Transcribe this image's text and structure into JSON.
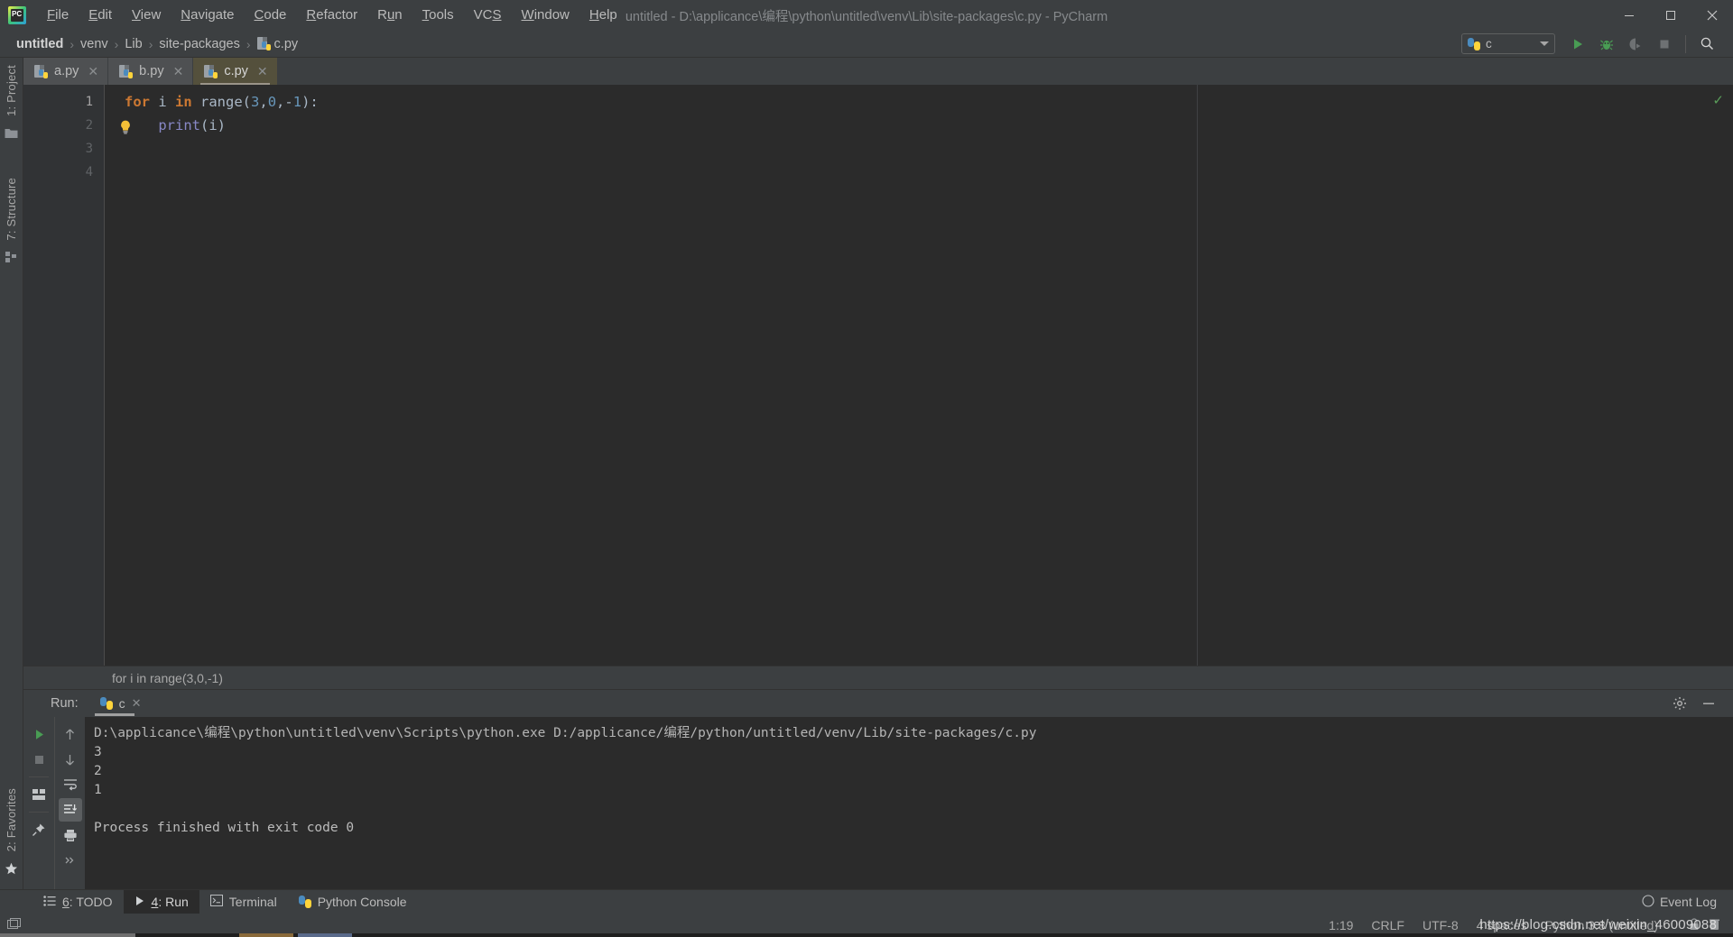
{
  "window": {
    "title": "untitled - D:\\applicance\\编程\\python\\untitled\\venv\\Lib\\site-packages\\c.py - PyCharm",
    "minimize_label": "minimize",
    "maximize_label": "maximize",
    "close_label": "close"
  },
  "menubar": {
    "items": [
      {
        "label": "File"
      },
      {
        "label": "Edit"
      },
      {
        "label": "View"
      },
      {
        "label": "Navigate"
      },
      {
        "label": "Code"
      },
      {
        "label": "Refactor"
      },
      {
        "label": "Run"
      },
      {
        "label": "Tools"
      },
      {
        "label": "VCS"
      },
      {
        "label": "Window"
      },
      {
        "label": "Help"
      }
    ]
  },
  "breadcrumb": {
    "items": [
      "untitled",
      "venv",
      "Lib",
      "site-packages",
      "c.py"
    ],
    "separator": "›"
  },
  "toolbar": {
    "run_config": "c",
    "run_label": "Run",
    "debug_label": "Debug",
    "coverage_label": "Run with Coverage",
    "stop_label": "Stop",
    "search_label": "Search Everywhere"
  },
  "sidebar_left": {
    "top": [
      {
        "label": "1: Project",
        "accesskey": "1"
      },
      {
        "label": "7: Structure",
        "accesskey": "7"
      }
    ],
    "bottom": [
      {
        "label": "2: Favorites",
        "accesskey": "2"
      }
    ]
  },
  "editor": {
    "tabs": [
      {
        "label": "a.py",
        "active": false
      },
      {
        "label": "b.py",
        "active": false
      },
      {
        "label": "c.py",
        "active": true
      }
    ],
    "line_numbers": [
      "1",
      "2",
      "3",
      "4"
    ],
    "code_lines": [
      {
        "tokens": [
          {
            "t": "for",
            "c": "kw"
          },
          {
            "t": " i ",
            "c": "pnc"
          },
          {
            "t": "in",
            "c": "kw"
          },
          {
            "t": " range",
            "c": "pnc"
          },
          {
            "t": "(",
            "c": "pnc"
          },
          {
            "t": "3",
            "c": "num"
          },
          {
            "t": ",",
            "c": "pnc"
          },
          {
            "t": "0",
            "c": "num"
          },
          {
            "t": ",-",
            "c": "pnc"
          },
          {
            "t": "1",
            "c": "num"
          },
          {
            "t": "):",
            "c": "pnc"
          }
        ]
      },
      {
        "indent": 4,
        "tokens": [
          {
            "t": "print",
            "c": "fn"
          },
          {
            "t": "(i)",
            "c": "pnc"
          }
        ]
      },
      {
        "tokens": []
      },
      {
        "tokens": []
      }
    ],
    "intention_bulb": "lightbulb-icon",
    "inspection_status": "✓",
    "footer_breadcrumb": "for i in range(3,0,-1)"
  },
  "run_panel": {
    "title": "Run:",
    "tab_label": "c",
    "settings_label": "Settings",
    "minimize_label": "Hide",
    "console_lines": [
      "D:\\applicance\\编程\\python\\untitled\\venv\\Scripts\\python.exe D:/applicance/编程/python/untitled/venv/Lib/site-packages/c.py",
      "3",
      "2",
      "1",
      "",
      "Process finished with exit code 0"
    ],
    "side_buttons_a": [
      "rerun-icon",
      "stop-icon",
      "layout-icon",
      "pin-icon"
    ],
    "side_buttons_b": [
      "up-arrow-icon",
      "down-arrow-icon",
      "soft-wrap-icon",
      "scroll-to-end-icon",
      "print-icon",
      "more-icon"
    ]
  },
  "bottom_tabs": [
    {
      "label": "6: TODO",
      "accesskey": "6",
      "icon": "todo-icon",
      "active": false
    },
    {
      "label": "4: Run",
      "accesskey": "4",
      "icon": "run-icon",
      "active": true
    },
    {
      "label": "Terminal",
      "icon": "terminal-icon",
      "active": false
    },
    {
      "label": "Python Console",
      "icon": "python-icon",
      "active": false
    }
  ],
  "bottom_right": {
    "event_log": "Event Log"
  },
  "statusbar": {
    "caret_position": "1:19",
    "line_separator": "CRLF",
    "encoding": "UTF-8",
    "indent": "4 spaces",
    "interpreter": "Python 3.8 (untitled)",
    "watermark": "https://blog.csdn.net/weixin_46009088"
  },
  "colors": {
    "chrome": "#3c3f41",
    "editor_bg": "#2b2b2b",
    "gutter_bg": "#313335",
    "tab_active": "#54503c",
    "accent_green": "#499c54",
    "keyword": "#cc7832",
    "number": "#6897bb",
    "text": "#bbbbbb"
  }
}
